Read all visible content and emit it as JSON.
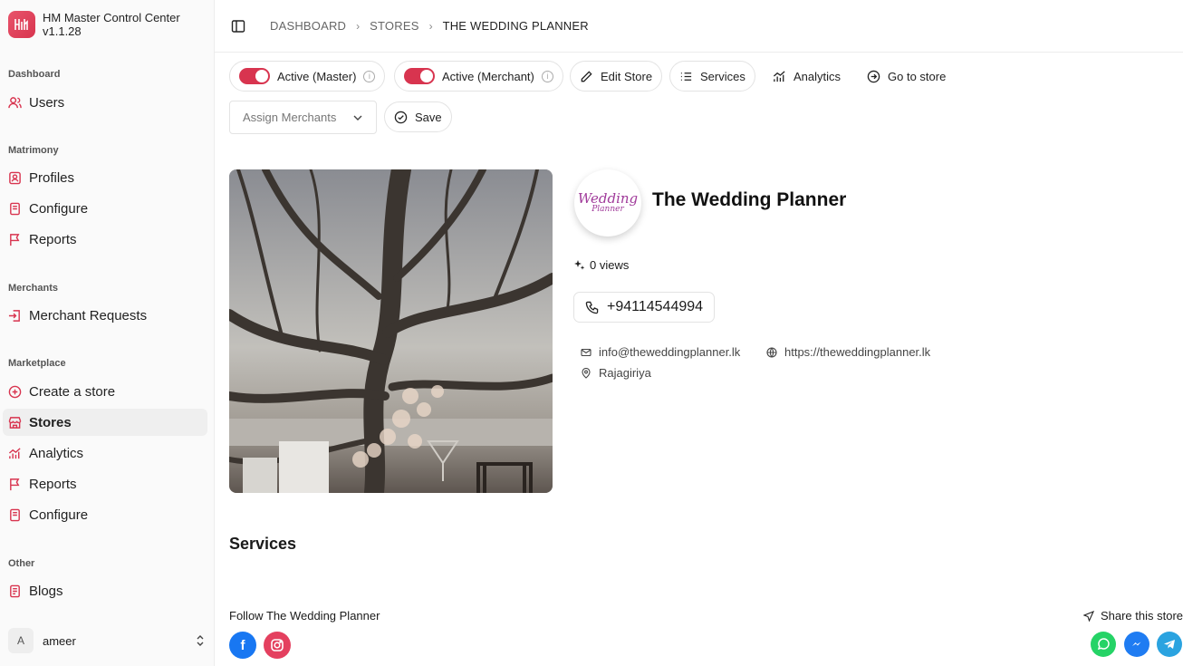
{
  "app": {
    "name": "HM Master Control Center",
    "version": "v1.1.28",
    "logo_text": "H"
  },
  "sidebar": {
    "sections": [
      {
        "label": "Dashboard",
        "items": [
          {
            "label": "Users",
            "icon": "users-icon"
          }
        ]
      },
      {
        "label": "Matrimony",
        "items": [
          {
            "label": "Profiles",
            "icon": "profile-icon"
          },
          {
            "label": "Configure",
            "icon": "configure-icon"
          },
          {
            "label": "Reports",
            "icon": "flag-icon"
          }
        ]
      },
      {
        "label": "Merchants",
        "items": [
          {
            "label": "Merchant Requests",
            "icon": "login-icon"
          }
        ]
      },
      {
        "label": "Marketplace",
        "items": [
          {
            "label": "Create a store",
            "icon": "plus-circle-icon"
          },
          {
            "label": "Stores",
            "icon": "store-icon",
            "active": true
          },
          {
            "label": "Analytics",
            "icon": "analytics-icon"
          },
          {
            "label": "Reports",
            "icon": "flag-icon"
          },
          {
            "label": "Configure",
            "icon": "configure-icon"
          }
        ]
      },
      {
        "label": "Other",
        "items": [
          {
            "label": "Blogs",
            "icon": "blogs-icon"
          }
        ]
      }
    ],
    "user": {
      "initial": "A",
      "name": "ameer"
    }
  },
  "breadcrumb": [
    "DASHBOARD",
    "STORES",
    "THE WEDDING PLANNER"
  ],
  "toolbar": {
    "active_master": "Active (Master)",
    "active_merchant": "Active (Merchant)",
    "edit_store": "Edit Store",
    "services": "Services",
    "analytics": "Analytics",
    "go_to_store": "Go to store",
    "assign_placeholder": "Assign Merchants",
    "save": "Save"
  },
  "store": {
    "name": "The Wedding Planner",
    "logo_line1": "Wedding",
    "logo_line2": "Planner",
    "views": "0 views",
    "phone": "+94114544994",
    "email": "info@theweddingplanner.lk",
    "website": "https://theweddingplanner.lk",
    "location": "Rajagiriya"
  },
  "services_heading": "Services",
  "follow_label": "Follow The Wedding Planner",
  "share_label": "Share this store",
  "colors": {
    "accent": "#d8344f",
    "facebook": "#1877f2",
    "instagram": "#e4405f",
    "whatsapp": "#25d366",
    "messenger": "#1f7cf2",
    "telegram": "#2aa3e0"
  }
}
